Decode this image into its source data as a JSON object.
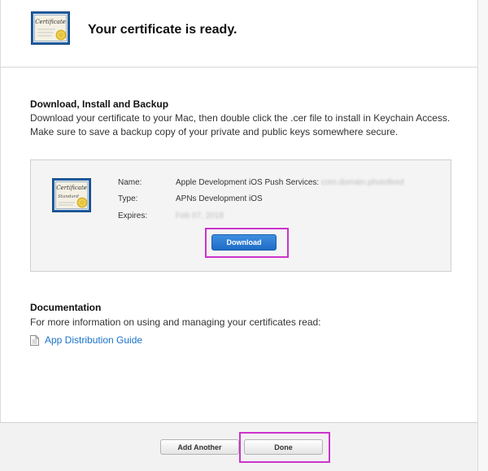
{
  "header": {
    "title": "Your certificate is ready.",
    "icon": "certificate-icon"
  },
  "download_section": {
    "heading": "Download, Install and Backup",
    "description": "Download your certificate to your Mac, then double click the .cer file to install in Keychain Access. Make sure to save a backup copy of your private and public keys somewhere secure."
  },
  "certificate": {
    "icon_label": "Certificate",
    "icon_sublabel": "Standard",
    "name_label": "Name:",
    "name_value": "Apple Development iOS Push Services:",
    "name_value_redacted": "com.domain.photofeed",
    "type_label": "Type:",
    "type_value": "APNs Development iOS",
    "expires_label": "Expires:",
    "expires_value_redacted": "Feb 07, 2018",
    "download_label": "Download"
  },
  "documentation": {
    "heading": "Documentation",
    "description": "For more information on using and managing your certificates read:",
    "link_label": "App Distribution Guide",
    "link_icon": "document-icon"
  },
  "footer": {
    "add_another_label": "Add Another",
    "done_label": "Done"
  },
  "colors": {
    "link": "#1a73c9",
    "primary_button": "#2a7bd4",
    "highlight": "#cc33cc",
    "certificate_frame": "#1f5fa8",
    "seal": "#e6c43a"
  }
}
